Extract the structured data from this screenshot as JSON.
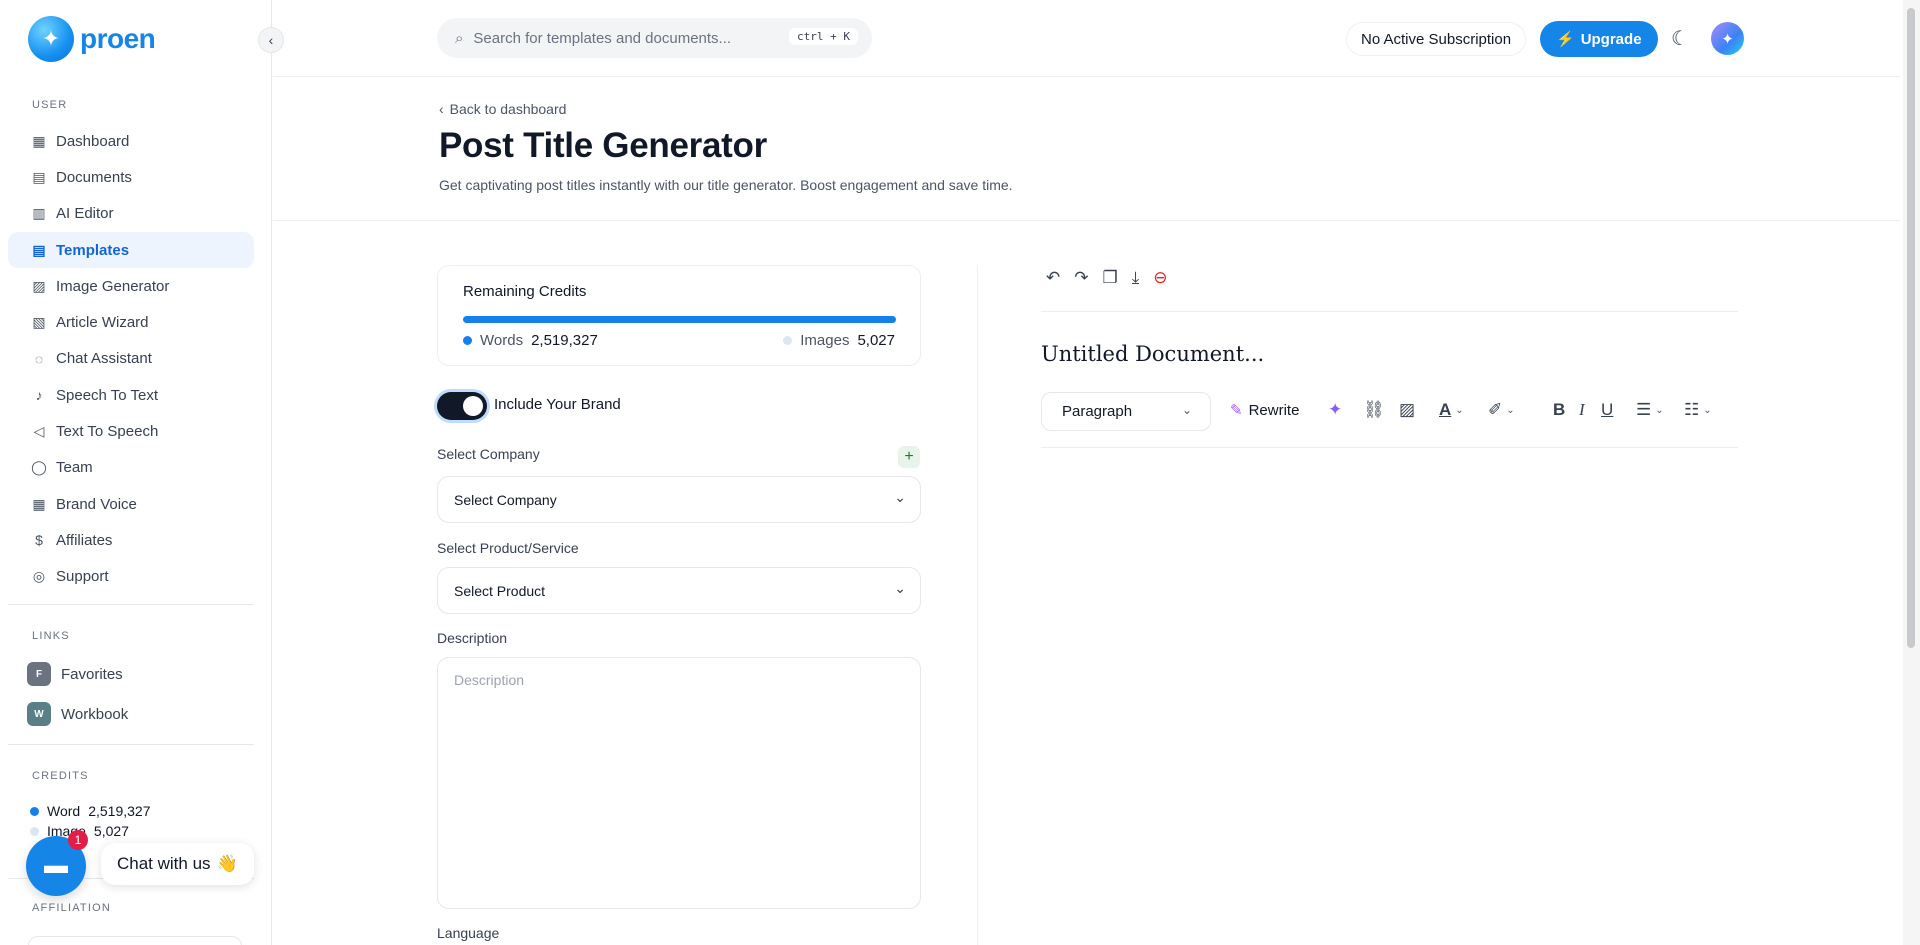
{
  "brand": {
    "name": "proen"
  },
  "sidebar": {
    "user_label": "USER",
    "items": [
      {
        "label": "Dashboard",
        "icon": "grid-icon",
        "glyph": "▦"
      },
      {
        "label": "Documents",
        "icon": "archive-icon",
        "glyph": "▤"
      },
      {
        "label": "AI Editor",
        "icon": "book-icon",
        "glyph": "▥"
      },
      {
        "label": "Templates",
        "icon": "template-icon",
        "glyph": "▤",
        "active": true
      },
      {
        "label": "Image Generator",
        "icon": "image-icon",
        "glyph": "▨"
      },
      {
        "label": "Article Wizard",
        "icon": "article-icon",
        "glyph": "▧"
      },
      {
        "label": "Chat Assistant",
        "icon": "chat-bubble-icon",
        "glyph": "◌"
      },
      {
        "label": "Speech To Text",
        "icon": "microphone-icon",
        "glyph": "♪"
      },
      {
        "label": "Text To Speech",
        "icon": "speaker-icon",
        "glyph": "◁"
      },
      {
        "label": "Team",
        "icon": "user-plus-icon",
        "glyph": "◯"
      },
      {
        "label": "Brand Voice",
        "icon": "layout-icon",
        "glyph": "▦"
      },
      {
        "label": "Affiliates",
        "icon": "dollar-icon",
        "glyph": "$"
      },
      {
        "label": "Support",
        "icon": "lifebuoy-icon",
        "glyph": "◎"
      }
    ],
    "links_label": "LINKS",
    "links": [
      {
        "badge": "F",
        "label": "Favorites",
        "color": "#6b7280"
      },
      {
        "badge": "W",
        "label": "Workbook",
        "color": "#5b7f86"
      }
    ],
    "credits_label": "CREDITS",
    "credits": [
      {
        "label": "Word",
        "value": "2,519,327",
        "color": "#1380ec"
      },
      {
        "label": "Image",
        "value": "5,027",
        "color": "#dbe6f3"
      }
    ],
    "affiliation_label": "AFFILIATION",
    "chat": {
      "count": "1",
      "text": "Chat with us",
      "emoji": "👋"
    }
  },
  "header": {
    "search_placeholder": "Search for templates and documents...",
    "shortcut": "ctrl + K",
    "subscription": "No Active Subscription",
    "upgrade": "Upgrade"
  },
  "page": {
    "back": "Back to dashboard",
    "title": "Post Title Generator",
    "description": "Get captivating post titles instantly with our title generator. Boost engagement and save time."
  },
  "form": {
    "remaining_credits": "Remaining Credits",
    "words_label": "Words",
    "words_value": "2,519,327",
    "images_label": "Images",
    "images_value": "5,027",
    "include_brand": "Include Your Brand",
    "company_label": "Select Company",
    "company_value": "Select Company",
    "product_label": "Select Product/Service",
    "product_value": "Select Product",
    "description_label": "Description",
    "description_placeholder": "Description",
    "language_label": "Language"
  },
  "editor": {
    "doc_title": "Untitled Document...",
    "paragraph": "Paragraph",
    "rewrite": "Rewrite"
  }
}
